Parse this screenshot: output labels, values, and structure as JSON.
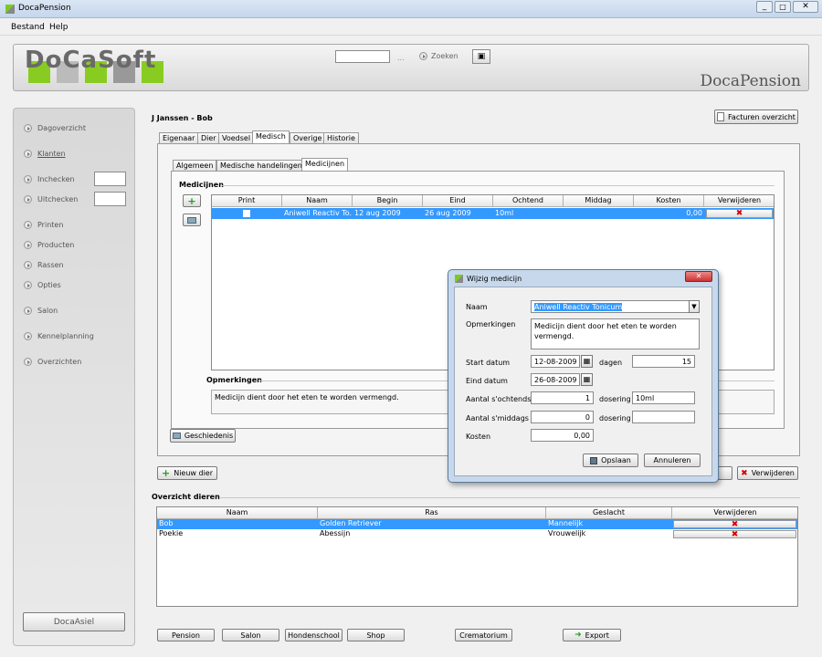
{
  "window": {
    "title": "DocaPension"
  },
  "menu": [
    "Bestand",
    "Help"
  ],
  "header": {
    "logo": "DoCaSoft",
    "search_dots": "...",
    "search_label": "Zoeken",
    "brand": "DocaPension",
    "invoices_button": "Facturen overzicht"
  },
  "sidebar": {
    "items": [
      "Dagoverzicht",
      "Klanten",
      "Inchecken",
      "Uitchecken",
      "Printen",
      "Producten",
      "Rassen",
      "Opties",
      "Salon",
      "Kennelplanning",
      "Overzichten"
    ],
    "asiel_button": "DocaAsiel"
  },
  "customer": {
    "name": "J Janssen - Bob"
  },
  "tabs": [
    "Eigenaar",
    "Dier",
    "Voedsel",
    "Medisch",
    "Overige",
    "Historie"
  ],
  "subtabs": [
    "Algemeen",
    "Medische handelingen",
    "Medicijnen"
  ],
  "medicines": {
    "title": "Medicijnen",
    "columns": [
      "Print",
      "Naam",
      "Begin",
      "Eind",
      "Ochtend",
      "Middag",
      "Kosten",
      "Verwijderen"
    ],
    "rows": [
      {
        "naam": "Aniwell Reactiv To...",
        "begin": "12 aug 2009",
        "eind": "26 aug 2009",
        "ochtend": "10ml",
        "middag": "",
        "kosten": "0,00"
      }
    ]
  },
  "remarks": {
    "title": "Opmerkingen",
    "text": "Medicijn dient door het eten te worden vermengd."
  },
  "buttons": {
    "history": "Geschiedenis",
    "new_animal": "Nieuw dier",
    "delete": "Verwijderen"
  },
  "animals": {
    "title": "Overzicht dieren",
    "columns": [
      "Naam",
      "Ras",
      "Geslacht",
      "Verwijderen"
    ],
    "rows": [
      {
        "naam": "Bob",
        "ras": "Golden Retriever",
        "geslacht": "Mannelijk"
      },
      {
        "naam": "Poekie",
        "ras": "Abessijn",
        "geslacht": "Vrouwelijk"
      }
    ]
  },
  "bottom_buttons": [
    "Pension",
    "Salon",
    "Hondenschool",
    "Shop",
    "Crematorium",
    "Export"
  ],
  "dialog": {
    "title": "Wijzig medicijn",
    "naam_label": "Naam",
    "naam_value": "Aniwell Reactiv Tonicum",
    "opm_label": "Opmerkingen",
    "opm_value": "Medicijn dient door het eten te worden vermengd.",
    "start_label": "Start datum",
    "start_value": "12-08-2009",
    "dagen_label": "dagen",
    "dagen_value": "15",
    "eind_label": "Eind datum",
    "eind_value": "26-08-2009",
    "ochtend_label": "Aantal s'ochtends",
    "ochtend_value": "1",
    "dosering_label": "dosering",
    "dosering1_value": "10ml",
    "middag_label": "Aantal s'middags",
    "middag_value": "0",
    "dosering2_value": "",
    "kosten_label": "Kosten",
    "kosten_value": "0,00",
    "save": "Opslaan",
    "cancel": "Annuleren"
  }
}
